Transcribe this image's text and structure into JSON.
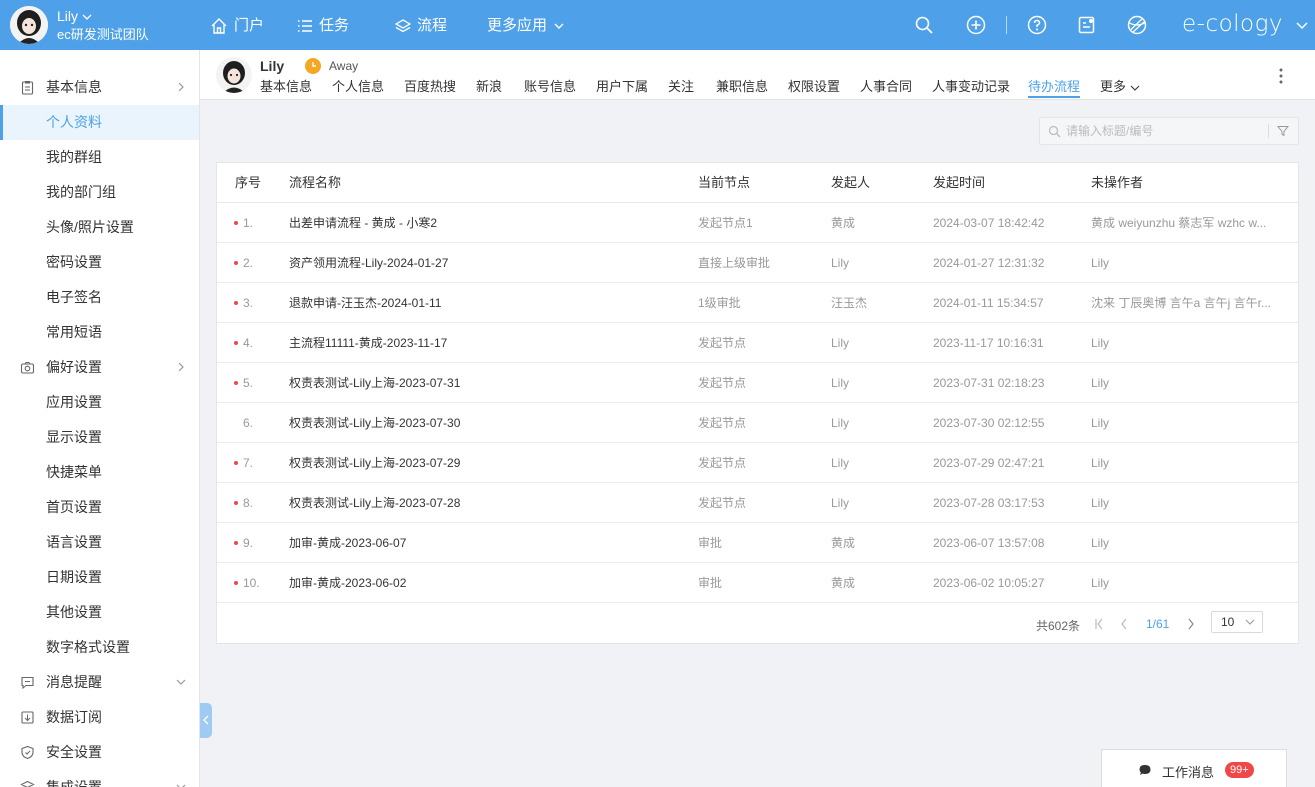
{
  "topbar": {
    "user_name": "Lily",
    "team": "ec研发测试团队",
    "brand": "e-cology",
    "nav": [
      {
        "label": "门户",
        "icon": "home-icon"
      },
      {
        "label": "任务",
        "icon": "list-icon"
      },
      {
        "label": "流程",
        "icon": "layers-icon"
      },
      {
        "label": "更多应用",
        "icon": "chevron-down-icon"
      }
    ],
    "tools": [
      "search-icon",
      "plus-circle-icon",
      "help-icon",
      "contacts-icon",
      "theme-icon"
    ]
  },
  "sidebar": {
    "items": [
      {
        "label": "基本信息",
        "icon": "clipboard-icon",
        "arrow": "right"
      },
      {
        "label": "个人资料",
        "active": true
      },
      {
        "label": "我的群组"
      },
      {
        "label": "我的部门组"
      },
      {
        "label": "头像/照片设置"
      },
      {
        "label": "密码设置"
      },
      {
        "label": "电子签名"
      },
      {
        "label": "常用短语"
      },
      {
        "label": "偏好设置",
        "icon": "camera-icon",
        "arrow": "right"
      },
      {
        "label": "应用设置"
      },
      {
        "label": "显示设置"
      },
      {
        "label": "快捷菜单"
      },
      {
        "label": "首页设置"
      },
      {
        "label": "语言设置"
      },
      {
        "label": "日期设置"
      },
      {
        "label": "其他设置"
      },
      {
        "label": "数字格式设置"
      },
      {
        "label": "消息提醒",
        "icon": "message-icon",
        "arrow": "down"
      },
      {
        "label": "数据订阅",
        "icon": "subscribe-icon"
      },
      {
        "label": "安全设置",
        "icon": "shield-icon"
      },
      {
        "label": "集成设置",
        "icon": "stack-icon",
        "arrow": "down"
      }
    ]
  },
  "profile": {
    "name": "Lily",
    "status": "Away",
    "tabs": [
      "基本信息",
      "个人信息",
      "百度热搜",
      "新浪",
      "账号信息",
      "用户下属",
      "关注",
      "兼职信息",
      "权限设置",
      "人事合同",
      "人事变动记录",
      "待办流程",
      "更多"
    ],
    "active_tab": "待办流程"
  },
  "search": {
    "placeholder": "请输入标题/编号"
  },
  "table": {
    "headers": [
      "序号",
      "流程名称",
      "当前节点",
      "发起人",
      "发起时间",
      "未操作者"
    ],
    "rows": [
      {
        "no": "1.",
        "unread": true,
        "name": " 出差申请流程 - 黄成 - 小寒2",
        "node": "发起节点1",
        "creator": "黄成",
        "time": "2024-03-07 18:42:42",
        "pending": "黄成 weiyunzhu 蔡志军 wzhc w..."
      },
      {
        "no": "2.",
        "unread": true,
        "name": "资产领用流程-Lily-2024-01-27",
        "node": "直接上级审批",
        "creator": "Lily",
        "time": "2024-01-27 12:31:32",
        "pending": "Lily"
      },
      {
        "no": "3.",
        "unread": true,
        "name": "退款申请-汪玉杰-2024-01-11",
        "node": "1级审批",
        "creator": "汪玉杰",
        "time": "2024-01-11 15:34:57",
        "pending": "沈来 丁辰奥博 言午a 言午j 言午r..."
      },
      {
        "no": "4.",
        "unread": true,
        "name": "主流程11111-黄成-2023-11-17",
        "node": "发起节点",
        "creator": "Lily",
        "time": "2023-11-17 10:16:31",
        "pending": "Lily"
      },
      {
        "no": "5.",
        "unread": true,
        "name": "权责表测试-Lily上海-2023-07-31",
        "node": "发起节点",
        "creator": "Lily",
        "time": "2023-07-31 02:18:23",
        "pending": "Lily"
      },
      {
        "no": "6.",
        "unread": false,
        "name": "权责表测试-Lily上海-2023-07-30",
        "node": "发起节点",
        "creator": "Lily",
        "time": "2023-07-30 02:12:55",
        "pending": "Lily"
      },
      {
        "no": "7.",
        "unread": true,
        "name": "权责表测试-Lily上海-2023-07-29",
        "node": "发起节点",
        "creator": "Lily",
        "time": "2023-07-29 02:47:21",
        "pending": "Lily"
      },
      {
        "no": "8.",
        "unread": true,
        "name": "权责表测试-Lily上海-2023-07-28",
        "node": "发起节点",
        "creator": "Lily",
        "time": "2023-07-28 03:17:53",
        "pending": "Lily"
      },
      {
        "no": "9.",
        "unread": true,
        "name": "加审-黄成-2023-06-07",
        "node": "审批",
        "creator": "黄成",
        "time": "2023-06-07 13:57:08",
        "pending": "Lily"
      },
      {
        "no": "10.",
        "unread": true,
        "name": "加审-黄成-2023-06-02",
        "node": "审批",
        "creator": "黄成",
        "time": "2023-06-02 10:05:27",
        "pending": "Lily"
      }
    ]
  },
  "pagination": {
    "total": "共602条",
    "page": "1/61",
    "page_size": "10"
  },
  "message": {
    "label": "工作消息",
    "badge": "99+"
  },
  "colors": {
    "primary": "#4ea1e8",
    "unread_dot": "#e94b4b",
    "status_away": "#f5a623",
    "badge": "#f04848"
  }
}
